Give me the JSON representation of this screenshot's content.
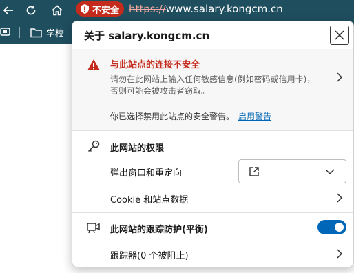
{
  "browser": {
    "security_label": "不安全",
    "url_scheme": "https://",
    "url_host": "www.salary.kongcm.cn",
    "bookmark_label": "学校",
    "colors": {
      "chrome_bg": "#1f4e5f",
      "insecure": "#c42b1c"
    }
  },
  "popup": {
    "title": "关于 salary.kongcm.cn",
    "warning": {
      "title": "与此站点的连接不安全",
      "desc_line1": "请勿在此网站上输入任何敏感信息(例如密码或信用卡)，",
      "desc_line2": "否则可能会被攻击者窃取。",
      "disabled_note": "你已选择禁用此站点的安全警告。",
      "enable_link": "启用警告"
    },
    "permissions": {
      "title": "此网站的权限",
      "popups_label": "弹出窗口和重定向",
      "cookie_label": "Cookie 和站点数据"
    },
    "tracking": {
      "title": "此网站的跟踪防护(平衡)",
      "enabled": true,
      "trackers_label": "跟踪器(0 个被阻止)"
    }
  },
  "icons": {
    "back": "back-arrow-icon",
    "refresh": "refresh-icon",
    "home": "home-icon",
    "shield": "shield-warning-icon",
    "warning": "warning-triangle-icon",
    "key": "key-icon",
    "camera": "tracking-camera-icon",
    "external": "open-external-icon",
    "chevron_right": "chevron-right-icon",
    "chevron_down": "chevron-down-icon",
    "close": "close-icon",
    "folder": "folder-icon"
  }
}
